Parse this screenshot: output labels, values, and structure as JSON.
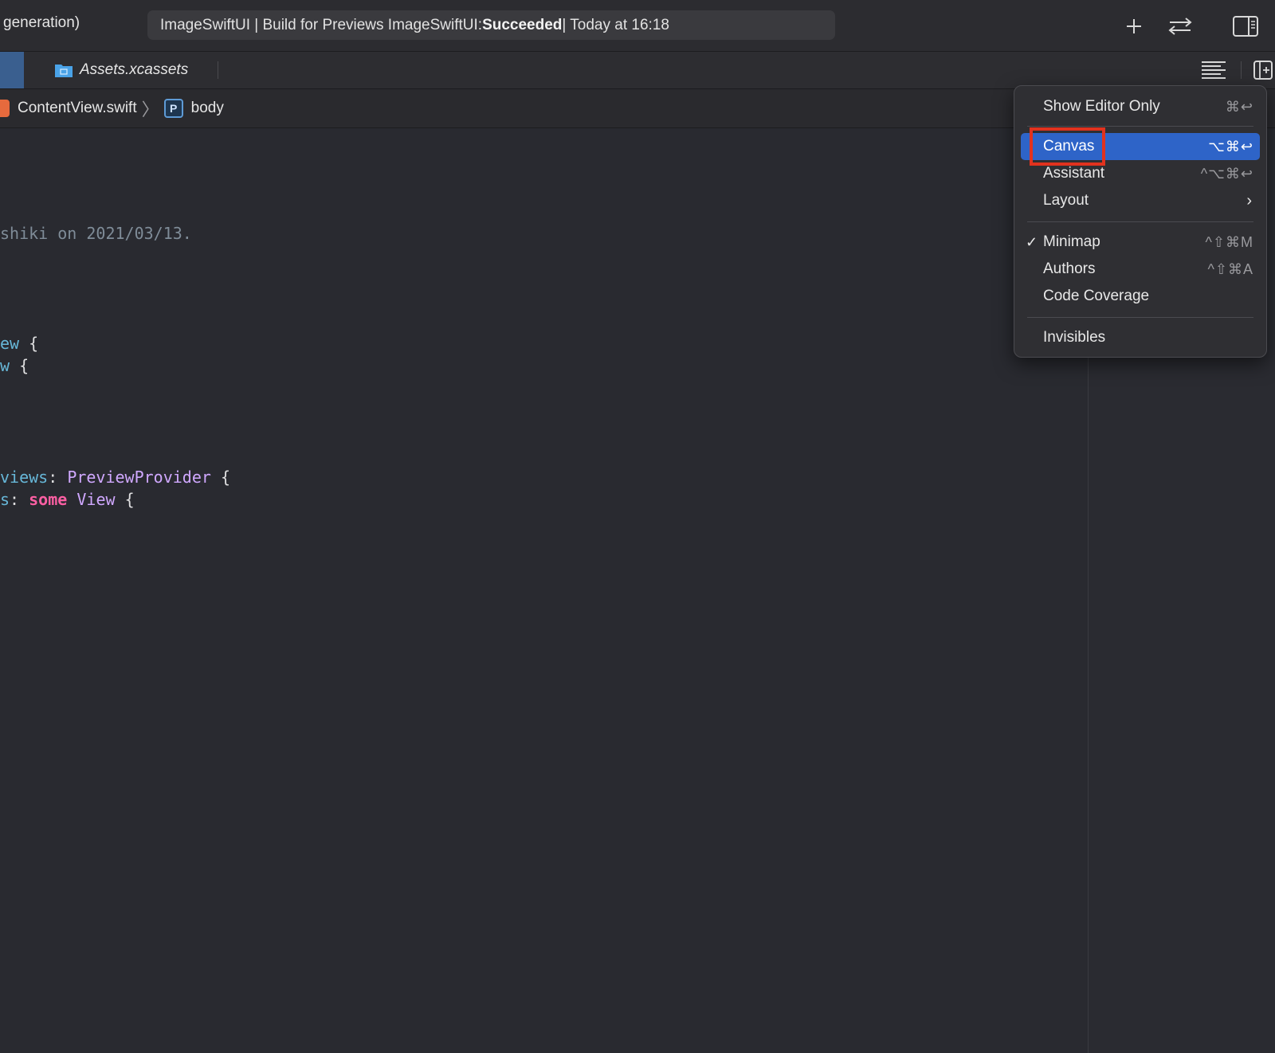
{
  "toolbar": {
    "scheme": "generation)",
    "status_prefix": "ImageSwiftUI | Build for Previews ImageSwiftUI: ",
    "status_result": "Succeeded",
    "status_suffix": " | Today at 16:18"
  },
  "tabs": [
    {
      "label": "Assets.xcassets",
      "icon": "folder-icon"
    }
  ],
  "jumpbar": {
    "file": "ContentView.swift",
    "symbol_badge": "P",
    "symbol": "body"
  },
  "code_lines": [
    {
      "parts": [
        {
          "cls": "c-comment",
          "text": "shiki on 2021/03/13."
        }
      ]
    },
    {
      "parts": [
        {
          "cls": "c-decl",
          "text": "ew"
        },
        {
          "cls": "c-plain",
          "text": " {"
        }
      ]
    },
    {
      "parts": [
        {
          "cls": "c-decl",
          "text": "w"
        },
        {
          "cls": "c-plain",
          "text": " {"
        }
      ]
    },
    {
      "parts": [
        {
          "cls": "c-decl",
          "text": "views"
        },
        {
          "cls": "c-plain",
          "text": ": "
        },
        {
          "cls": "c-type",
          "text": "PreviewProvider"
        },
        {
          "cls": "c-plain",
          "text": " {"
        }
      ]
    },
    {
      "parts": [
        {
          "cls": "c-decl",
          "text": "s"
        },
        {
          "cls": "c-plain",
          "text": ": "
        },
        {
          "cls": "c-kw",
          "text": "some"
        },
        {
          "cls": "c-plain",
          "text": " "
        },
        {
          "cls": "c-type",
          "text": "View"
        },
        {
          "cls": "c-plain",
          "text": " {"
        }
      ]
    }
  ],
  "menu": {
    "items": [
      {
        "label": "Show Editor Only",
        "shortcut": "⌘↩"
      },
      {
        "label": "Canvas",
        "shortcut": "⌥⌘↩",
        "highlighted": true
      },
      {
        "label": "Assistant",
        "shortcut": "^⌥⌘↩"
      },
      {
        "label": "Layout",
        "submenu": true
      },
      {
        "label": "Minimap",
        "shortcut": "^⇧⌘M",
        "checked": true
      },
      {
        "label": "Authors",
        "shortcut": "^⇧⌘A"
      },
      {
        "label": "Code Coverage"
      },
      {
        "label": "Invisibles"
      }
    ],
    "check_glyph": "✓",
    "chevron_glyph": "›"
  },
  "colors": {
    "highlight": "#2e64c8",
    "callout": "#e2321e",
    "editor_bg": "#292a30"
  }
}
